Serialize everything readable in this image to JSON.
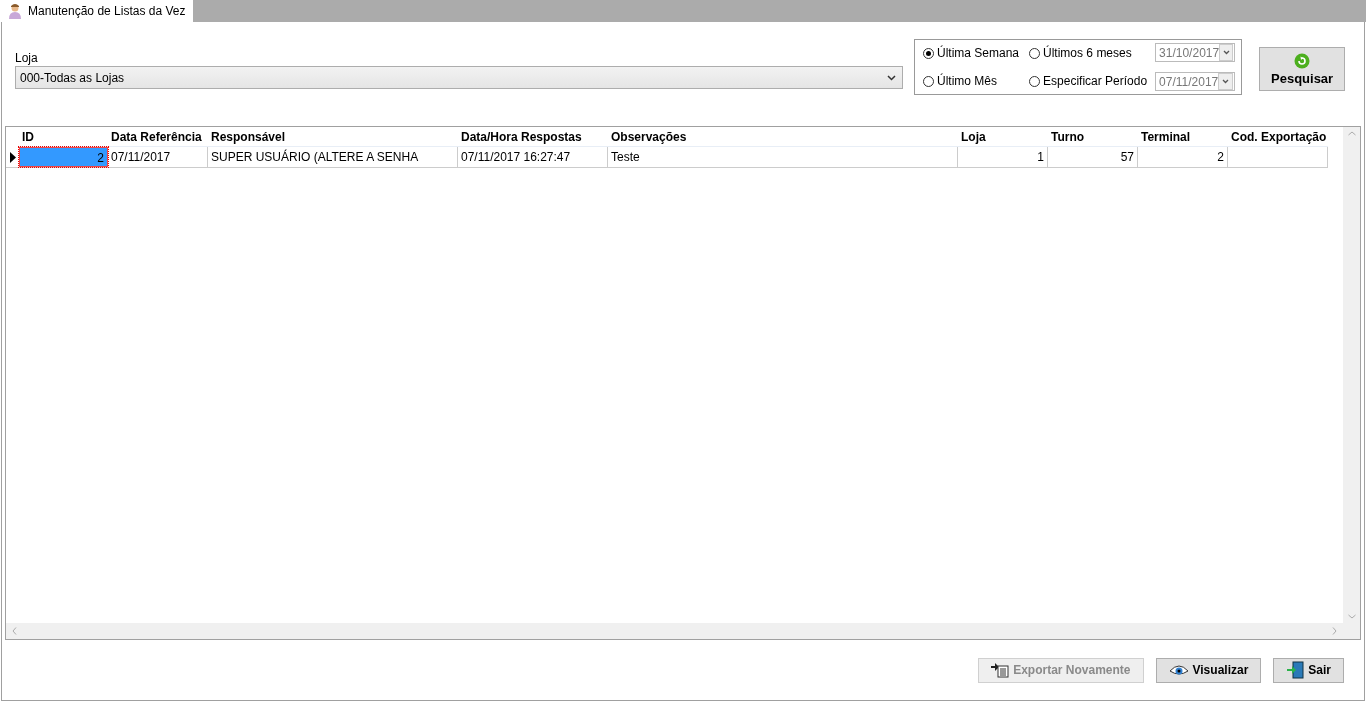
{
  "tabs": [
    {
      "label": "Manutenção de Listas da Vez",
      "selected": true
    }
  ],
  "store": {
    "label": "Loja",
    "value": "000-Todas as Lojas"
  },
  "period": {
    "options": [
      {
        "label": "Última Semana",
        "selected": true
      },
      {
        "label": "Últimos 6 meses",
        "selected": false
      },
      {
        "label": "Último Mês",
        "selected": false
      },
      {
        "label": "Especificar Período",
        "selected": false
      }
    ],
    "dates": [
      "31/10/2017",
      "07/11/2017"
    ]
  },
  "search_button": {
    "label": "Pesquisar"
  },
  "table": {
    "columns": [
      {
        "label": "ID",
        "kind": "number"
      },
      {
        "label": "Data Referência",
        "kind": "text"
      },
      {
        "label": "Responsável",
        "kind": "text"
      },
      {
        "label": "Data/Hora Respostas",
        "kind": "text"
      },
      {
        "label": "Observações",
        "kind": "text"
      },
      {
        "label": "Loja",
        "kind": "number"
      },
      {
        "label": "Turno",
        "kind": "number"
      },
      {
        "label": "Terminal",
        "kind": "number"
      },
      {
        "label": "Cod. Exportação",
        "kind": "text"
      }
    ],
    "rows": [
      {
        "selected": true,
        "cells": [
          "2",
          "07/11/2017",
          "SUPER USUÁRIO (ALTERE A SENHA",
          "07/11/2017 16:27:47",
          "Teste",
          "1",
          "57",
          "2",
          ""
        ]
      }
    ]
  },
  "buttons": [
    {
      "label": "Exportar Novamente",
      "kind": "export",
      "disabled": true
    },
    {
      "label": "Visualizar",
      "kind": "view",
      "disabled": false
    },
    {
      "label": "Sair",
      "kind": "exit",
      "disabled": false
    }
  ]
}
